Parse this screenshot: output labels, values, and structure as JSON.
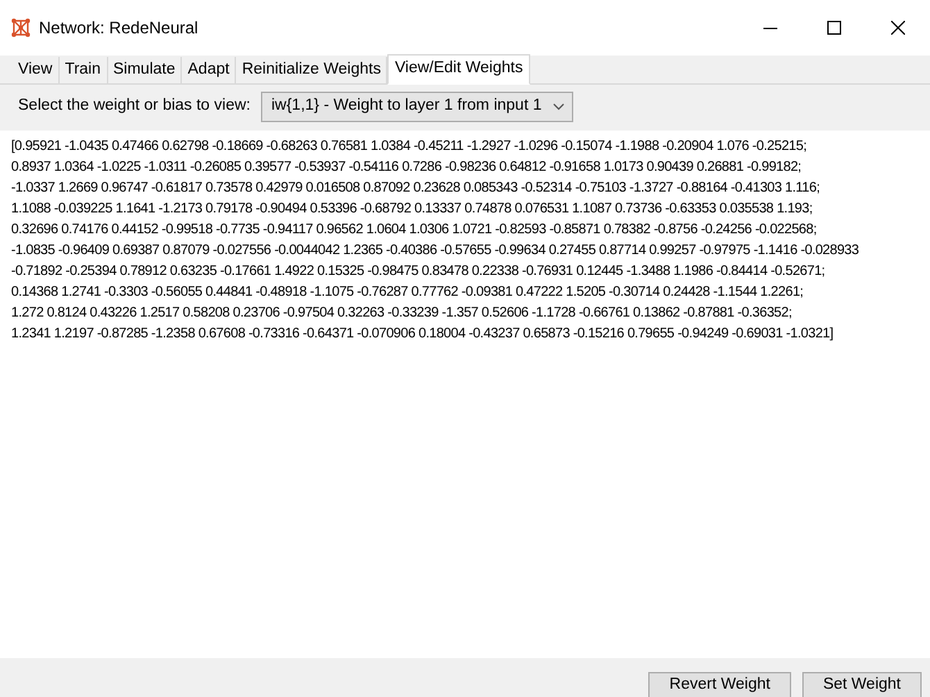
{
  "window": {
    "title": "Network: RedeNeural"
  },
  "tabs": [
    {
      "label": "View",
      "selected": false
    },
    {
      "label": "Train",
      "selected": false
    },
    {
      "label": "Simulate",
      "selected": false
    },
    {
      "label": "Adapt",
      "selected": false
    },
    {
      "label": "Reinitialize Weights",
      "selected": false
    },
    {
      "label": "View/Edit Weights",
      "selected": true
    }
  ],
  "selector": {
    "label": "Select the weight or bias to view:",
    "value": "iw{1,1} - Weight to layer 1 from input 1"
  },
  "weights_lines": [
    "[0.95921 -1.0435 0.47466 0.62798 -0.18669 -0.68263 0.76581 1.0384 -0.45211 -1.2927 -1.0296 -0.15074 -1.1988 -0.20904 1.076 -0.25215;",
    "0.8937 1.0364 -1.0225 -1.0311 -0.26085 0.39577 -0.53937 -0.54116 0.7286 -0.98236 0.64812 -0.91658 1.0173 0.90439 0.26881 -0.99182;",
    "-1.0337 1.2669 0.96747 -0.61817 0.73578 0.42979 0.016508 0.87092 0.23628 0.085343 -0.52314 -0.75103 -1.3727 -0.88164 -0.41303 1.116;",
    "1.1088 -0.039225 1.1641 -1.2173 0.79178 -0.90494 0.53396 -0.68792 0.13337 0.74878 0.076531 1.1087 0.73736 -0.63353 0.035538 1.193;",
    "0.32696 0.74176 0.44152 -0.99518 -0.7735 -0.94117 0.96562 1.0604 1.0306 1.0721 -0.82593 -0.85871 0.78382 -0.8756 -0.24256 -0.022568;",
    "-1.0835 -0.96409 0.69387 0.87079 -0.027556 -0.0044042 1.2365 -0.40386 -0.57655 -0.99634 0.27455 0.87714 0.99257 -0.97975 -1.1416 -0.028933",
    "-0.71892 -0.25394 0.78912 0.63235 -0.17661 1.4922 0.15325 -0.98475 0.83478 0.22338 -0.76931 0.12445 -1.3488 1.1986 -0.84414 -0.52671;",
    "0.14368 1.2741 -0.3303 -0.56055 0.44841 -0.48918 -1.1075 -0.76287 0.77762 -0.09381 0.47222 1.5205 -0.30714 0.24428 -1.1544 1.2261;",
    "1.272 0.8124 0.43226 1.2517 0.58208 0.23706 -0.97504 0.32263 -0.33239 -1.357 0.52606 -1.1728 -0.66761 0.13862 -0.87881 -0.36352;",
    "1.2341 1.2197 -0.87285 -1.2358 0.67608 -0.73316 -0.64371 -0.070906 0.18004 -0.43237 0.65873 -0.15216 0.79655 -0.94249 -0.69031 -1.0321]"
  ],
  "buttons": [
    "Revert Weight",
    "Set Weight"
  ]
}
